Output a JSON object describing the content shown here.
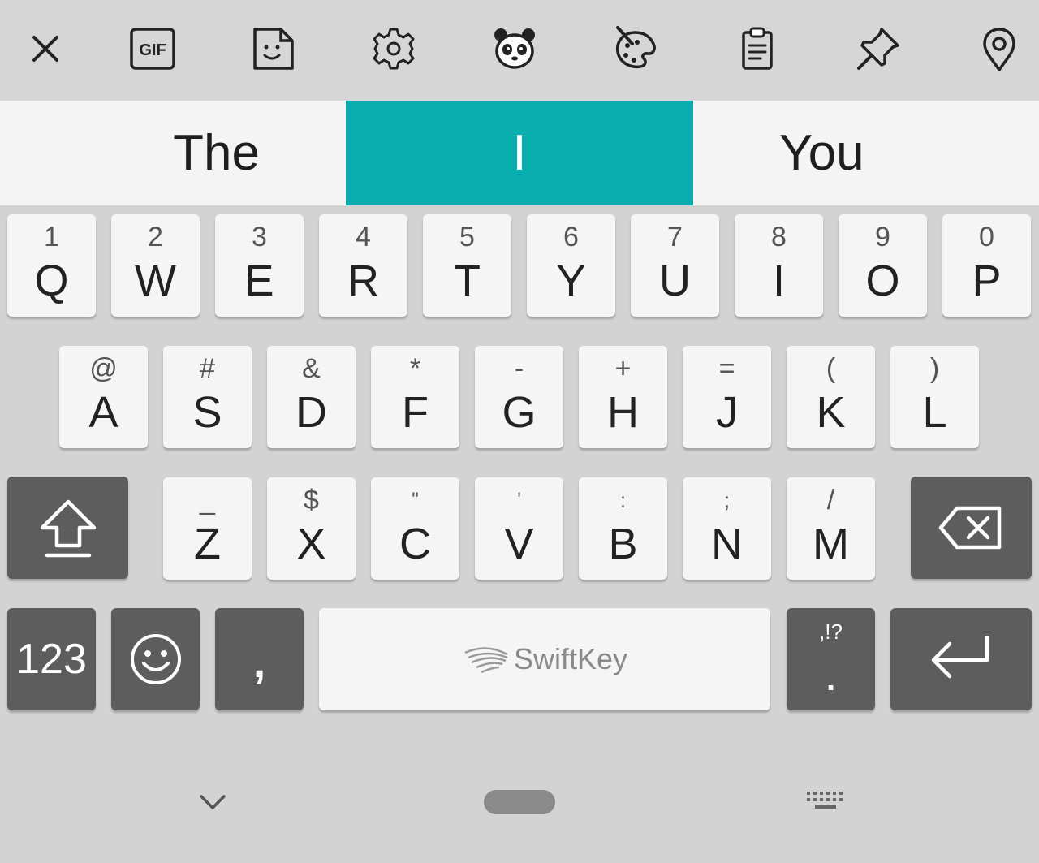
{
  "toolbar": {
    "items": [
      {
        "name": "close-icon"
      },
      {
        "name": "gif-icon",
        "label": "GIF"
      },
      {
        "name": "sticker-icon"
      },
      {
        "name": "settings-gear-icon"
      },
      {
        "name": "panda-icon"
      },
      {
        "name": "theme-palette-icon"
      },
      {
        "name": "clipboard-icon"
      },
      {
        "name": "pin-icon"
      },
      {
        "name": "location-pin-icon"
      }
    ]
  },
  "suggestions": [
    {
      "text": "The",
      "selected": false
    },
    {
      "text": "I",
      "selected": true
    },
    {
      "text": "You",
      "selected": false
    }
  ],
  "keyboard": {
    "row1": [
      {
        "hint": "1",
        "main": "Q"
      },
      {
        "hint": "2",
        "main": "W"
      },
      {
        "hint": "3",
        "main": "E"
      },
      {
        "hint": "4",
        "main": "R"
      },
      {
        "hint": "5",
        "main": "T"
      },
      {
        "hint": "6",
        "main": "Y"
      },
      {
        "hint": "7",
        "main": "U"
      },
      {
        "hint": "8",
        "main": "I"
      },
      {
        "hint": "9",
        "main": "O"
      },
      {
        "hint": "0",
        "main": "P"
      }
    ],
    "row2": [
      {
        "hint": "@",
        "main": "A"
      },
      {
        "hint": "#",
        "main": "S"
      },
      {
        "hint": "&",
        "main": "D"
      },
      {
        "hint": "*",
        "main": "F"
      },
      {
        "hint": "-",
        "main": "G"
      },
      {
        "hint": "+",
        "main": "H"
      },
      {
        "hint": "=",
        "main": "J"
      },
      {
        "hint": "(",
        "main": "K"
      },
      {
        "hint": ")",
        "main": "L"
      }
    ],
    "row3": [
      {
        "hint": "_",
        "main": "Z"
      },
      {
        "hint": "$",
        "main": "X"
      },
      {
        "hint": "\"",
        "main": "C"
      },
      {
        "hint": "'",
        "main": "V"
      },
      {
        "hint": ":",
        "main": "B"
      },
      {
        "hint": ";",
        "main": "N"
      },
      {
        "hint": "/",
        "main": "M"
      }
    ],
    "numbers_label": "123",
    "comma_label": ",",
    "space_brand": "SwiftKey",
    "punct_hint": ",!?",
    "punct_main": "."
  },
  "colors": {
    "accent": "#0aadad",
    "key_light": "#f5f5f5",
    "key_dark": "#5d5d5d",
    "background": "#d3d3d3"
  }
}
